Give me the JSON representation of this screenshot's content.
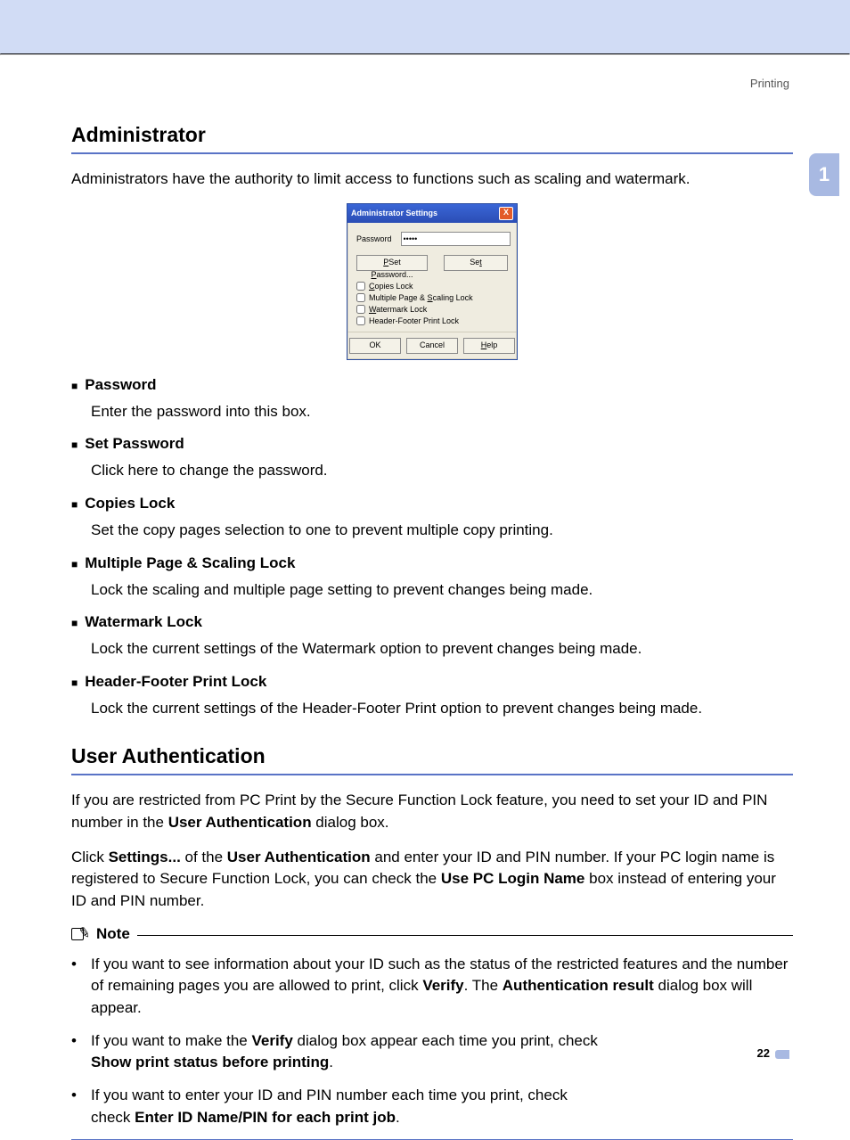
{
  "running_head": "Printing",
  "side_tab": "1",
  "page_number": "22",
  "section1": {
    "title": "Administrator",
    "intro": "Administrators have the authority to limit access to functions such as scaling and watermark."
  },
  "dialog": {
    "title": "Administrator Settings",
    "close_label": "X",
    "password_label": "Password",
    "password_value": "•••••",
    "set_password_btn": "Set Password...",
    "set_btn": "Set",
    "chk_copies": "Copies Lock",
    "chk_multiple": "Multiple Page & Scaling Lock",
    "chk_watermark": "Watermark Lock",
    "chk_header_footer": "Header-Footer Print Lock",
    "ok_btn": "OK",
    "cancel_btn": "Cancel",
    "help_btn": "Help"
  },
  "defs": [
    {
      "head": "Password",
      "body": "Enter the password into this box."
    },
    {
      "head": "Set Password",
      "body": "Click here to change the password."
    },
    {
      "head": "Copies Lock",
      "body": "Set the copy pages selection to one to prevent multiple copy printing."
    },
    {
      "head": "Multiple Page & Scaling Lock",
      "body": "Lock the scaling and multiple page setting to prevent changes being made."
    },
    {
      "head": "Watermark Lock",
      "body": "Lock the current settings of the Watermark option to prevent changes being made."
    },
    {
      "head": "Header-Footer Print Lock",
      "body": "Lock the current settings of the Header-Footer Print option to prevent changes being made."
    }
  ],
  "section2": {
    "title": "User Authentication",
    "p1_a": "If you are restricted from PC Print by the Secure Function Lock feature, you need to set your ID and PIN number in the ",
    "p1_b": "User Authentication",
    "p1_c": " dialog box.",
    "p2_a": "Click ",
    "p2_b": "Settings...",
    "p2_c": " of the ",
    "p2_d": "User Authentication",
    "p2_e": " and enter your ID and PIN number. If your PC login name is registered to Secure Function Lock, you can check the ",
    "p2_f": "Use PC Login Name",
    "p2_g": " box instead of entering your ID and PIN number."
  },
  "note": {
    "title": "Note",
    "items": [
      {
        "a": "If you want to see information about your ID such as the status of the restricted features and the number of remaining pages you are allowed to print, click ",
        "b": "Verify",
        "c": ". The ",
        "d": "Authentication result",
        "e": " dialog box will appear."
      },
      {
        "a": "If you want to make the ",
        "b": "Verify",
        "c": " dialog box appear each time you print, check ",
        "d": "Show print status before printing",
        "e": "."
      },
      {
        "a": "If you want to enter your ID and PIN number each time you print, check ",
        "b": "Enter ID Name/PIN for each print job",
        "c": ".",
        "d": "",
        "e": ""
      }
    ]
  }
}
